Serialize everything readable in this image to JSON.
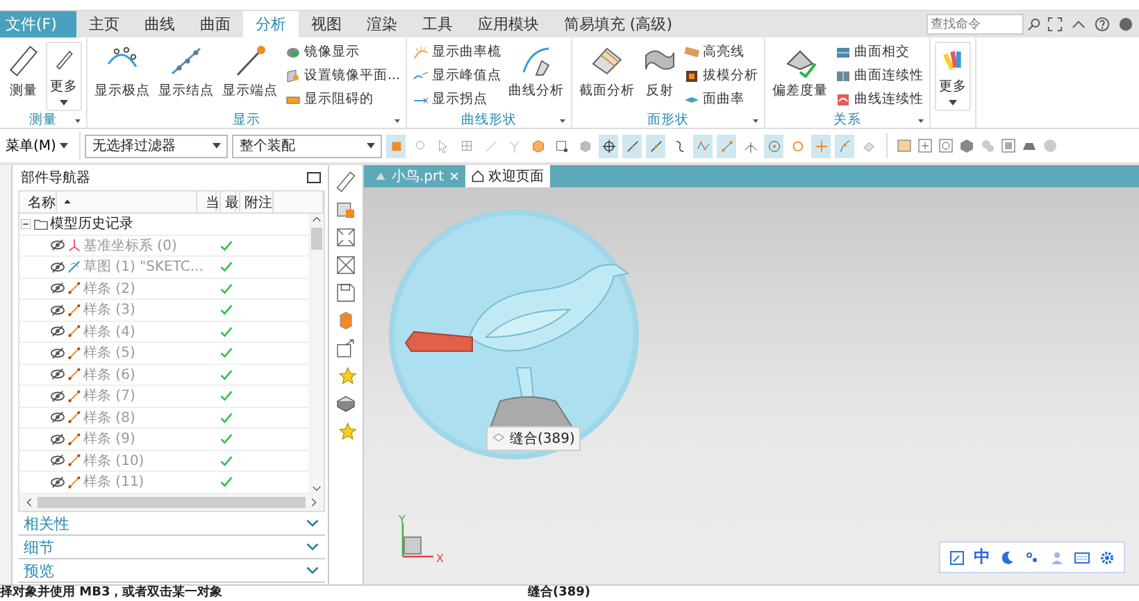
{
  "tabs": {
    "file_menu": "文件(F)",
    "items": [
      {
        "label": "主页",
        "selected": false
      },
      {
        "label": "曲线",
        "selected": false
      },
      {
        "label": "曲面",
        "selected": false
      },
      {
        "label": "分析",
        "selected": true
      },
      {
        "label": "视图",
        "selected": false
      },
      {
        "label": "渲染",
        "selected": false
      },
      {
        "label": "工具",
        "selected": false
      },
      {
        "label": "应用模块",
        "selected": false
      },
      {
        "label": "简易填充 (高级)",
        "selected": false
      }
    ]
  },
  "search": {
    "placeholder": "查找命令"
  },
  "ribbon": [
    {
      "label": "测量",
      "items": [
        {
          "kind": "large",
          "label": "测量"
        },
        {
          "kind": "dropdown",
          "label": "更多"
        }
      ]
    },
    {
      "label": "显示",
      "items": [
        {
          "kind": "large",
          "label": "显示极点"
        },
        {
          "kind": "large",
          "label": "显示结点"
        },
        {
          "kind": "large",
          "label": "显示端点"
        },
        {
          "kind": "small",
          "label": "镜像显示"
        },
        {
          "kind": "small",
          "label": "设置镜像平面..."
        },
        {
          "kind": "small",
          "label": "显示阻碍的"
        }
      ]
    },
    {
      "label": "曲线形状",
      "items": [
        {
          "kind": "small",
          "label": "显示曲率梳"
        },
        {
          "kind": "small",
          "label": "显示峰值点"
        },
        {
          "kind": "small",
          "label": "显示拐点"
        },
        {
          "kind": "large",
          "label": "曲线分析"
        }
      ]
    },
    {
      "label": "面形状",
      "items": [
        {
          "kind": "large",
          "label": "截面分析"
        },
        {
          "kind": "large",
          "label": "反射"
        },
        {
          "kind": "small",
          "label": "高亮线"
        },
        {
          "kind": "small",
          "label": "拔模分析"
        },
        {
          "kind": "small",
          "label": "面曲率"
        }
      ]
    },
    {
      "label": "关系",
      "items": [
        {
          "kind": "large",
          "label": "偏差度量"
        },
        {
          "kind": "small",
          "label": "曲面相交"
        },
        {
          "kind": "small",
          "label": "曲面连续性"
        },
        {
          "kind": "small",
          "label": "曲线连续性"
        }
      ]
    },
    {
      "items": [
        {
          "kind": "dropdown",
          "label": "更多"
        }
      ]
    }
  ],
  "toolbar": {
    "menu": "菜单(M)",
    "filters": [
      {
        "value": "无选择过滤器"
      },
      {
        "value": "整个装配"
      }
    ],
    "snaps": [
      {
        "on": true
      },
      {
        "on": false
      },
      {
        "on": false
      },
      {
        "on": false
      },
      {
        "on": false
      },
      {
        "on": false
      },
      {
        "on": false
      },
      {
        "on": false
      },
      {
        "on": false
      },
      {
        "on": true
      },
      {
        "on": true
      },
      {
        "on": true
      },
      {
        "on": false
      },
      {
        "on": true
      },
      {
        "on": true
      },
      {
        "on": false
      },
      {
        "on": true
      },
      {
        "on": false
      },
      {
        "on": true
      },
      {
        "on": true
      },
      {
        "on": false
      }
    ]
  },
  "navigator": {
    "title": "部件导航器",
    "columns": [
      "名称",
      "当",
      "最",
      "附注"
    ],
    "tree": [
      {
        "label": "模型历史记录",
        "expanded": true,
        "children": [
          {
            "kind": "datum",
            "label": "基准坐标系 (0)",
            "checked": true
          },
          {
            "kind": "sketch",
            "label": "草图 (1) \"SKETC...",
            "checked": true
          },
          {
            "kind": "spline",
            "label": "样条 (2)",
            "checked": true
          },
          {
            "kind": "spline",
            "label": "样条 (3)",
            "checked": true
          },
          {
            "kind": "spline",
            "label": "样条 (4)",
            "checked": true
          },
          {
            "kind": "spline",
            "label": "样条 (5)",
            "checked": true
          },
          {
            "kind": "spline",
            "label": "样条 (6)",
            "checked": true
          },
          {
            "kind": "spline",
            "label": "样条 (7)",
            "checked": true
          },
          {
            "kind": "spline",
            "label": "样条 (8)",
            "checked": true
          },
          {
            "kind": "spline",
            "label": "样条 (9)",
            "checked": true
          },
          {
            "kind": "spline",
            "label": "样条 (10)",
            "checked": true
          },
          {
            "kind": "spline",
            "label": "样条 (11)",
            "checked": true
          }
        ]
      }
    ],
    "sections": [
      {
        "label": "相关性",
        "expanded": false
      },
      {
        "label": "细节",
        "expanded": false
      },
      {
        "label": "预览",
        "expanded": false
      }
    ]
  },
  "viewport": {
    "tabs": [
      {
        "label": "小鸟.prt",
        "selected": true
      },
      {
        "label": "欢迎页面",
        "selected": false
      }
    ],
    "tooltip": "缝合(389)",
    "axes": {
      "x": "X",
      "y": "Y"
    },
    "ime": {
      "mode": "中"
    }
  },
  "status_bar": {
    "prompt": "择对象并使用 MB3，或者双击某一对象",
    "selection": "缝合(389)"
  }
}
